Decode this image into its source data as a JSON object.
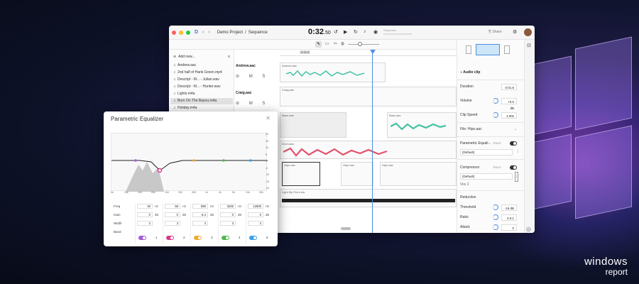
{
  "titlebar": {
    "project": "Demo Project",
    "separator": "/",
    "sequence": "Sequence",
    "timecode": "0:32",
    "timecode_frac": ".50",
    "seq_label": "Sequence",
    "share": "Share"
  },
  "toolbar": {
    "add_label": "Add new..."
  },
  "sidebar": {
    "items": [
      {
        "name": "Andrew.aac",
        "selected": false
      },
      {
        "name": "2nd half of Hank Green.mp4",
        "selected": false
      },
      {
        "name": "Descript - M... - Julian.wav",
        "selected": false
      },
      {
        "name": "Descript - M... - Hunter.wav",
        "selected": false
      },
      {
        "name": "Lights.m4a",
        "selected": false
      },
      {
        "name": "Born On The Bayou.m4a",
        "selected": true
      },
      {
        "name": "Holiday.m4a",
        "selected": false
      }
    ]
  },
  "tracks": [
    {
      "name": "Andrew.aac",
      "controls": "⊘ M S"
    },
    {
      "name": "Craig.aac",
      "controls": "⊘ M S"
    }
  ],
  "ruler": {
    "marker": "0:32.5"
  },
  "clips": {
    "andrew": "Andrew.aac",
    "craig": "Craig.aac",
    "bass": "Bass.wav",
    "bass2": "Bass.aac",
    "drums": "Drum.aac",
    "hipo1": "Hipo.aac",
    "hipo2": "Hipo.aac",
    "hipo3": "Hipo.aac",
    "lights": "Light My Fire.m4a"
  },
  "properties": {
    "header": "Audio clip",
    "duration": {
      "label": "Duration",
      "value": "0:01.6"
    },
    "volume": {
      "label": "Volume",
      "value": "+0.0 dB"
    },
    "speed": {
      "label": "Clip Speed",
      "value": "1.00x"
    },
    "file": {
      "label": "File",
      "value": "Hipo.aac"
    },
    "peq": {
      "label": "Parametric Equali...",
      "badge": "TRACK",
      "preset": "(Default)"
    },
    "comp": {
      "label": "Compressor",
      "badge": "TRACK",
      "preset": "(Default)",
      "extra": "Vox 2"
    },
    "reduction": {
      "label": "Reduction"
    },
    "threshold": {
      "label": "Threshold",
      "value": "-16 dB"
    },
    "ratio": {
      "label": "Ratio",
      "value": "3.0:1"
    },
    "attack": {
      "label": "Attack",
      "value": "0"
    }
  },
  "eq": {
    "title": "Parametric Equalizer",
    "xticks": [
      "5k",
      "10k",
      "20k",
      "50k",
      "100",
      "200",
      "500",
      "1k",
      "2k",
      "5k",
      "10k",
      "20k"
    ],
    "yticks": [
      "20",
      "15",
      "10",
      "5",
      "0",
      "-5",
      "-10",
      "-15",
      "-20"
    ],
    "param_labels": [
      "Freq",
      "Gain",
      "Width",
      "Band"
    ],
    "bands": [
      {
        "freq": "40",
        "freq_unit": "Hz",
        "gain": "0",
        "gain_unit": "dB",
        "width": "2",
        "band": "1",
        "color": "#a35ad8"
      },
      {
        "freq": "58",
        "freq_unit": "Hz",
        "gain": "0",
        "gain_unit": "dB",
        "width": "3",
        "band": "2",
        "color": "#d83c8a"
      },
      {
        "freq": "980",
        "freq_unit": "Hz",
        "gain": "-6.4",
        "gain_unit": "dB",
        "width": "3",
        "band": "3",
        "color": "#f0a830"
      },
      {
        "freq": "3200",
        "freq_unit": "Hz",
        "gain": "0",
        "gain_unit": "dB",
        "width": "3",
        "band": "4",
        "color": "#4cba4c"
      },
      {
        "freq": "12600",
        "freq_unit": "Hz",
        "gain": "0",
        "gain_unit": "dB",
        "width": "3",
        "band": "5",
        "color": "#3aa0e8"
      }
    ]
  },
  "brand": {
    "line1": "windows",
    "line2": "report"
  },
  "colors": {
    "accent": "#4a90e2",
    "teal": "#45c1a4",
    "pink": "#e2526c",
    "bg": "#0d1228"
  }
}
